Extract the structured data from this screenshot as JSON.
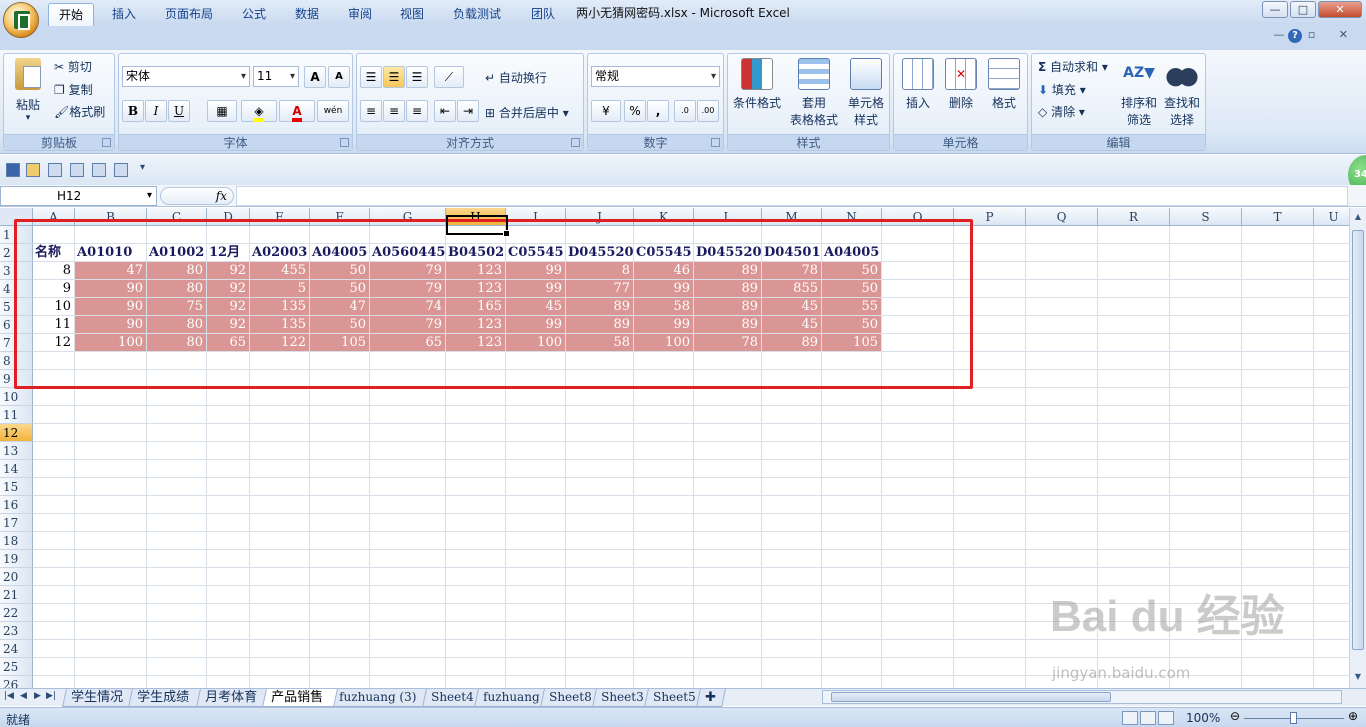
{
  "window": {
    "title": "两小无猜网密码.xlsx - Microsoft Excel",
    "min": "—",
    "max": "□",
    "close": "✕"
  },
  "tabs": [
    "开始",
    "插入",
    "页面布局",
    "公式",
    "数据",
    "审阅",
    "视图",
    "负载测试",
    "团队"
  ],
  "help_label": "?",
  "ribbon": {
    "clipboard": {
      "label": "剪贴板",
      "paste": "粘贴",
      "cut": "剪切",
      "copy": "复制",
      "format_painter": "格式刷"
    },
    "font": {
      "label": "字体",
      "name": "宋体",
      "size": "11",
      "bold": "B",
      "italic": "I",
      "underline": "U",
      "grow": "A",
      "shrink": "A",
      "font_color": "A",
      "phonetic": "wén"
    },
    "alignment": {
      "label": "对齐方式",
      "wrap": "自动换行",
      "merge": "合并后居中"
    },
    "number": {
      "label": "数字",
      "format": "常规",
      "percent": "%",
      "comma": ",",
      "inc_decimal": ".0",
      "dec_decimal": ".00"
    },
    "styles": {
      "label": "样式",
      "conditional": "条件格式",
      "table_l1": "套用",
      "table_l2": "表格格式",
      "cell_l1": "单元格",
      "cell_l2": "样式"
    },
    "cells": {
      "label": "单元格",
      "insert": "插入",
      "delete": "删除",
      "format": "格式"
    },
    "editing": {
      "label": "编辑",
      "autosum": "自动求和",
      "fill": "填充",
      "clear": "清除",
      "sort_l1": "排序和",
      "sort_l2": "筛选",
      "find_l1": "查找和",
      "find_l2": "选择"
    }
  },
  "name_box": "H12",
  "fx_label": "fx",
  "badge": "34",
  "columns": [
    "A",
    "B",
    "C",
    "D",
    "E",
    "F",
    "G",
    "H",
    "I",
    "J",
    "K",
    "L",
    "M",
    "N",
    "O",
    "P",
    "Q",
    "R",
    "S",
    "T",
    "U"
  ],
  "selected_column": "H",
  "rows": [
    "1",
    "2",
    "3",
    "4",
    "5",
    "6",
    "7",
    "8",
    "9",
    "10",
    "11",
    "12",
    "13",
    "14",
    "15",
    "16",
    "17",
    "18",
    "19",
    "20",
    "21",
    "22",
    "23",
    "24",
    "25",
    "26"
  ],
  "selected_row": "12",
  "sheet": {
    "header_row": [
      "名称",
      "A01010",
      "A01002",
      "12月",
      "A02003",
      "A04005",
      "A0560445",
      "B04502",
      "C05545",
      "D045520",
      "C05545",
      "D045520",
      "D04501",
      "A04005"
    ],
    "data_rows": [
      [
        "8",
        "47",
        "80",
        "92",
        "455",
        "50",
        "79",
        "123",
        "99",
        "8",
        "46",
        "89",
        "78",
        "50"
      ],
      [
        "9",
        "90",
        "80",
        "92",
        "5",
        "50",
        "79",
        "123",
        "99",
        "77",
        "99",
        "89",
        "855",
        "50"
      ],
      [
        "10",
        "90",
        "75",
        "92",
        "135",
        "47",
        "74",
        "165",
        "45",
        "89",
        "58",
        "89",
        "45",
        "55"
      ],
      [
        "11",
        "90",
        "80",
        "92",
        "135",
        "50",
        "79",
        "123",
        "99",
        "89",
        "99",
        "89",
        "45",
        "50"
      ],
      [
        "12",
        "100",
        "80",
        "65",
        "122",
        "105",
        "65",
        "123",
        "100",
        "58",
        "100",
        "78",
        "89",
        "105"
      ]
    ]
  },
  "sheet_tabs": [
    "学生情况",
    "学生成绩",
    "月考体育",
    "产品销售",
    "fuzhuang (3)",
    "Sheet4",
    "fuzhuang",
    "Sheet8",
    "Sheet3",
    "Sheet5"
  ],
  "active_sheet": "产品销售",
  "status": {
    "ready": "就绪",
    "zoom": "100%"
  },
  "watermark": {
    "brand": "Bai du 经验",
    "url": "jingyan.baidu.com"
  },
  "colors": {
    "data_fill": "#da9694",
    "selected_header": "#f1b43b",
    "annotation_box": "#e02020"
  }
}
